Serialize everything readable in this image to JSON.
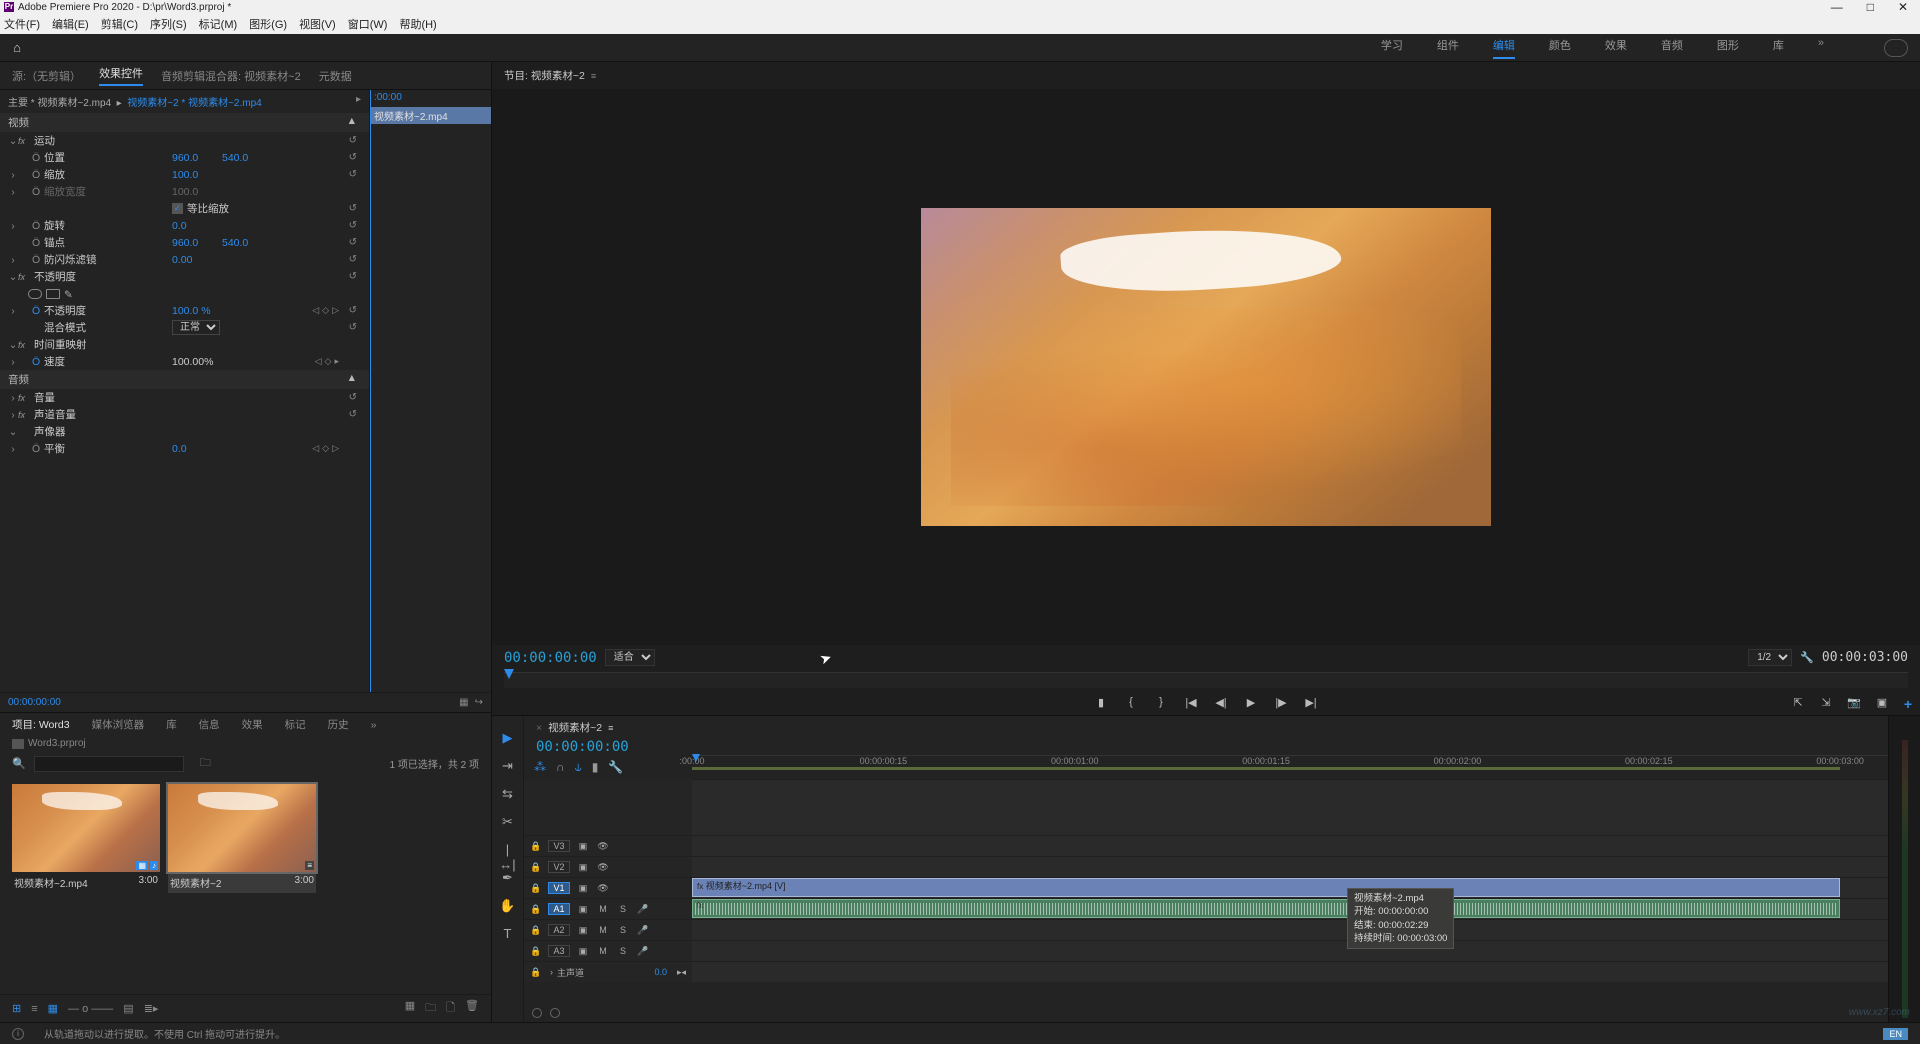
{
  "titlebar": {
    "app": "Adobe Premiere Pro 2020",
    "file": "D:\\pr\\Word3.prproj *"
  },
  "menu": {
    "file": "文件(F)",
    "edit": "编辑(E)",
    "clip": "剪辑(C)",
    "sequence": "序列(S)",
    "markers": "标记(M)",
    "graphics": "图形(G)",
    "view": "视图(V)",
    "window": "窗口(W)",
    "help": "帮助(H)"
  },
  "workspaces": {
    "learning": "学习",
    "assembly": "组件",
    "editing": "编辑",
    "color": "颜色",
    "effects": "效果",
    "audio": "音频",
    "graphics": "图形",
    "libraries": "库"
  },
  "sourceTabs": {
    "source": "源:（无剪辑）",
    "effectControls": "效果控件",
    "audioMixer": "音频剪辑混合器: 视频素材~2",
    "metadata": "元数据"
  },
  "ec": {
    "breadcrumb1": "主要 * 视频素材~2.mp4",
    "breadcrumb2": "视频素材~2 * 视频素材~2.mp4",
    "videoHeader": "视频",
    "motion": "运动",
    "position": "位置",
    "posX": "960.0",
    "posY": "540.0",
    "scale": "缩放",
    "scaleVal": "100.0",
    "scaleWidth": "缩放宽度",
    "scaleWidthVal": "100.0",
    "uniform": "等比缩放",
    "rotation": "旋转",
    "rotationVal": "0.0",
    "anchor": "锚点",
    "anchorX": "960.0",
    "anchorY": "540.0",
    "antiFlicker": "防闪烁滤镜",
    "antiFlickerVal": "0.00",
    "opacity": "不透明度",
    "opacityProp": "不透明度",
    "opacityVal": "100.0 %",
    "blendMode": "混合模式",
    "blendModeVal": "正常",
    "timeRemap": "时间重映射",
    "speed": "速度",
    "speedVal": "100.00%",
    "audioHeader": "音频",
    "volume": "音量",
    "channelVolume": "声道音量",
    "panner": "声像器",
    "balance": "平衡",
    "balanceVal": "0.0",
    "rightTime": ":00:00",
    "rightClip": "视频素材~2.mp4",
    "footerTC": "00:00:00:00"
  },
  "program": {
    "title": "节目: 视频素材~2",
    "tc": "00:00:00:00",
    "fit": "适合",
    "res": "1/2",
    "duration": "00:00:03:00"
  },
  "project": {
    "tabs": {
      "project": "项目: Word3",
      "mediaBrowser": "媒体浏览器",
      "libraries": "库",
      "info": "信息",
      "effects": "效果",
      "markers": "标记",
      "history": "历史"
    },
    "name": "Word3.prproj",
    "status": "1 项已选择，共 2 项",
    "items": [
      {
        "name": "视频素材~2.mp4",
        "dur": "3:00"
      },
      {
        "name": "视频素材~2",
        "dur": "3:00"
      }
    ]
  },
  "timeline": {
    "title": "视频素材~2",
    "tc": "00:00:00:00",
    "ticks": [
      ":00:00",
      "00:00:00:15",
      "00:00:01:00",
      "00:00:01:15",
      "00:00:02:00",
      "00:00:02:15",
      "00:00:03:00"
    ],
    "v3": "V3",
    "v2": "V2",
    "v1": "V1",
    "a1": "A1",
    "a2": "A2",
    "a3": "A3",
    "master": "主声道",
    "masterVal": "0.0",
    "clipV": "视频素材~2.mp4 [V]",
    "tooltip": {
      "name": "视频素材~2.mp4",
      "startLabel": "开始:",
      "startVal": "00:00:00:00",
      "endLabel": "结束:",
      "endVal": "00:00:02:29",
      "durLabel": "持续时间:",
      "durVal": "00:00:03:00"
    }
  },
  "status": {
    "hint": "从轨道拖动以进行提取。不使用 Ctrl 拖动可进行提升。",
    "lang": "EN"
  }
}
